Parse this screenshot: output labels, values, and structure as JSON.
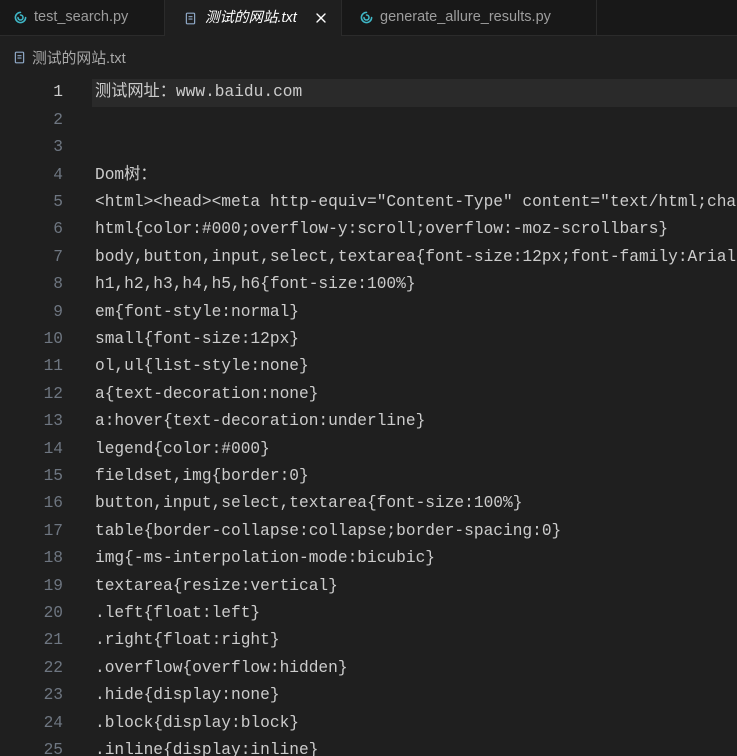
{
  "theme": {
    "tabbar_bg": "#181818",
    "editor_bg": "#1f1f1f",
    "editor_fg": "#cccccc",
    "tab_border": "#2b2b2b",
    "tab_inactive_fg": "#9d9d9d",
    "tab_active_fg": "#ffffff",
    "line_number": "#6e7681",
    "line_number_active": "#cccccc",
    "line_highlight": "#2a2a2a",
    "breadcrumb_fg": "#a9a9a9",
    "python_icon": "#3fb6c6",
    "text_file_icon": "#8fa9c7"
  },
  "tabs": [
    {
      "label": "test_search.py",
      "icon": "python-icon",
      "active": false
    },
    {
      "label": "测试的网站.txt",
      "icon": "text-file-icon",
      "active": true,
      "preview": true,
      "close_icon": "close-icon"
    },
    {
      "label": "generate_allure_results.py",
      "icon": "python-icon",
      "active": false
    }
  ],
  "breadcrumb": {
    "icon": "text-file-icon",
    "file_label": "测试的网站.txt"
  },
  "editor": {
    "active_line": 1,
    "lines": [
      {
        "num": 1,
        "text": "测试网址：www.baidu.com"
      },
      {
        "num": 2,
        "text": ""
      },
      {
        "num": 3,
        "text": ""
      },
      {
        "num": 4,
        "text": "Dom树："
      },
      {
        "num": 5,
        "text": "<html><head><meta http-equiv=\"Content-Type\" content=\"text/html;cha"
      },
      {
        "num": 6,
        "text": "html{color:#000;overflow-y:scroll;overflow:-moz-scrollbars}"
      },
      {
        "num": 7,
        "text": "body,button,input,select,textarea{font-size:12px;font-family:Arial"
      },
      {
        "num": 8,
        "text": "h1,h2,h3,h4,h5,h6{font-size:100%}"
      },
      {
        "num": 9,
        "text": "em{font-style:normal}"
      },
      {
        "num": 10,
        "text": "small{font-size:12px}"
      },
      {
        "num": 11,
        "text": "ol,ul{list-style:none}"
      },
      {
        "num": 12,
        "text": "a{text-decoration:none}"
      },
      {
        "num": 13,
        "text": "a:hover{text-decoration:underline}"
      },
      {
        "num": 14,
        "text": "legend{color:#000}"
      },
      {
        "num": 15,
        "text": "fieldset,img{border:0}"
      },
      {
        "num": 16,
        "text": "button,input,select,textarea{font-size:100%}"
      },
      {
        "num": 17,
        "text": "table{border-collapse:collapse;border-spacing:0}"
      },
      {
        "num": 18,
        "text": "img{-ms-interpolation-mode:bicubic}"
      },
      {
        "num": 19,
        "text": "textarea{resize:vertical}"
      },
      {
        "num": 20,
        "text": ".left{float:left}"
      },
      {
        "num": 21,
        "text": ".right{float:right}"
      },
      {
        "num": 22,
        "text": ".overflow{overflow:hidden}"
      },
      {
        "num": 23,
        "text": ".hide{display:none}"
      },
      {
        "num": 24,
        "text": ".block{display:block}"
      },
      {
        "num": 25,
        "text": ".inline{display:inline}"
      }
    ]
  }
}
